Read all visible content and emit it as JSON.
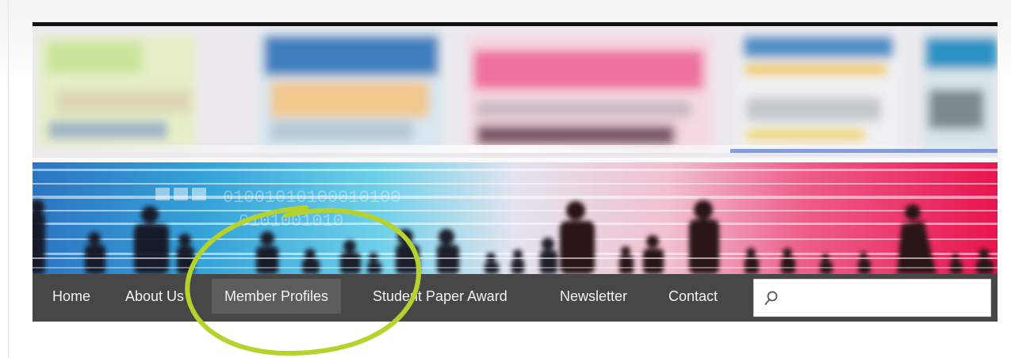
{
  "nav": {
    "items": [
      {
        "label": "Home"
      },
      {
        "label": "About Us"
      },
      {
        "label": "Member Profiles",
        "active": true
      },
      {
        "label": "Student Paper Award"
      },
      {
        "label": "Newsletter"
      },
      {
        "label": "Contact"
      }
    ]
  },
  "search": {
    "value": "",
    "placeholder": "",
    "icon": "search-icon"
  },
  "colors": {
    "nav_background": "#474747",
    "nav_active": "#5d5d5d",
    "annotation_circle": "#b6d32c"
  }
}
